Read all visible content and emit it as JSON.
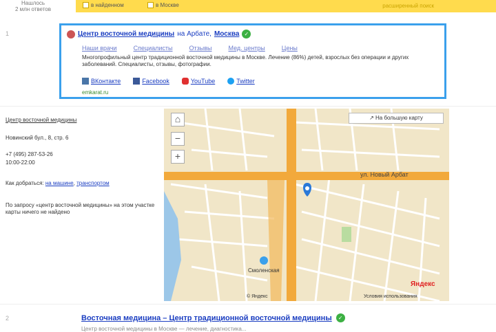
{
  "header": {
    "found_line1": "Нашлось",
    "found_line2": "2 млн ответов",
    "chk1": "в найденном",
    "chk2": "в Москве",
    "adv": "расширенный поиск"
  },
  "result1": {
    "num": "1",
    "title_link": "Центр восточной медицины",
    "title_mid": " на Арбате, ",
    "title_city": "Москва",
    "nav": [
      "Наши врачи",
      "Специалисты",
      "Отзывы",
      "Мед. центры",
      "Цены"
    ],
    "desc": "Многопрофильный центр традиционной восточной медицины в Москве. Лечение (86%) детей, взрослых без операции и других заболеваний. Специалисты, отзывы, фотографии.",
    "social": [
      {
        "label": "ВКонтакте",
        "color": "#4a76a8"
      },
      {
        "label": "Facebook",
        "color": "#3b5998"
      },
      {
        "label": "YouTube",
        "color": "#e03030"
      },
      {
        "label": "Twitter",
        "color": "#1da1f2"
      }
    ],
    "site": "emkarat.ru"
  },
  "sidebar": {
    "org_link": "Центр восточной медицины",
    "address": "Новинский бул., 8, стр. 6",
    "phone": "+7 (495) 287-53-26",
    "hours": "10:00-22:00",
    "directions_prefix": "Как добраться:",
    "directions_link1": "на машине",
    "directions_link2": "транспортом",
    "note": "По запросу «центр восточной медицины» на этом участке карты ничего не найдено"
  },
  "map": {
    "big_map_button": "На большую карту",
    "street_label": "ул. Новый Арбат",
    "metro_label": "Смоленская",
    "brand": "Яндекс",
    "footer_links": [
      "© Яндекс",
      "Условия использования"
    ]
  },
  "result2": {
    "num": "2",
    "title": "Восточная медицина – Центр традиционной восточной медицины",
    "snippet": "Центр восточной медицины в Москве — лечение, диагностика..."
  }
}
